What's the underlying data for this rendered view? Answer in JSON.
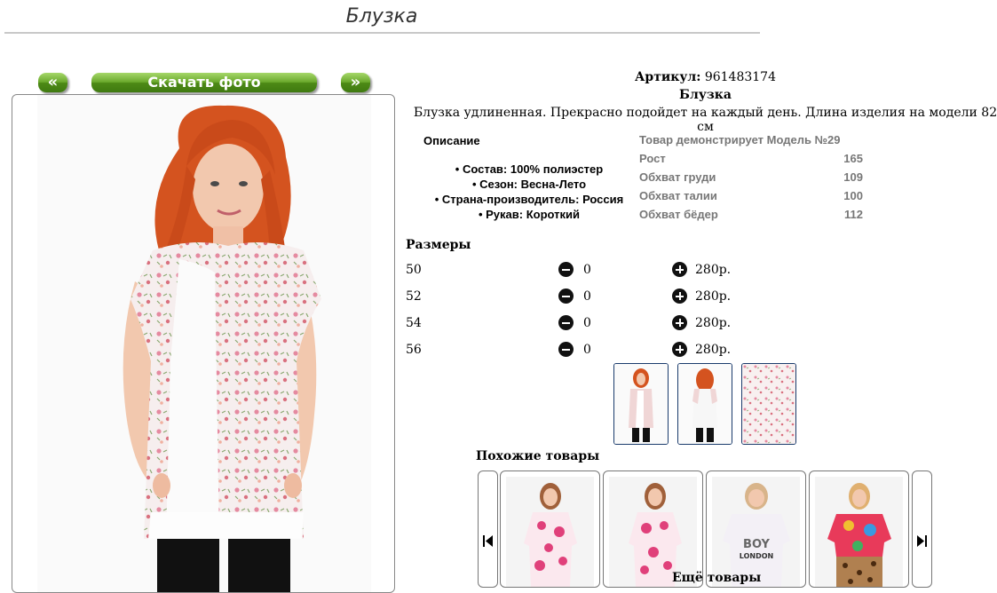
{
  "page": {
    "title": "Блузка"
  },
  "gallery": {
    "prev_label": "«",
    "next_label": "»",
    "download_label": "Скачать фото"
  },
  "product": {
    "sku_label": "Артикул:",
    "sku": "961483174",
    "name": "Блузка",
    "description": "Блузка удлиненная. Прекрасно подойдет на каждый день. Длина изделия на модели 82 см"
  },
  "details": {
    "heading": "Описание",
    "items": [
      "Состав: 100% полиэстер",
      "Сезон: Весна-Лето",
      "Страна-производитель: Россия",
      "Рукав: Короткий"
    ]
  },
  "model": {
    "heading": "Товар демонстрирует Модель №29",
    "rows": [
      {
        "label": "Рост",
        "value": "165"
      },
      {
        "label": "Обхват груди",
        "value": "109"
      },
      {
        "label": "Обхват талии",
        "value": "100"
      },
      {
        "label": "Обхват бёдер",
        "value": "112"
      }
    ]
  },
  "sizes": {
    "heading": "Размеры",
    "rows": [
      {
        "size": "50",
        "qty": "0",
        "price": "280р."
      },
      {
        "size": "52",
        "qty": "0",
        "price": "280р."
      },
      {
        "size": "54",
        "qty": "0",
        "price": "280р."
      },
      {
        "size": "56",
        "qty": "0",
        "price": "280р."
      }
    ]
  },
  "similar": {
    "heading": "Похожие товары",
    "card3_print_line1": "BOY",
    "card3_print_line2": "LONDON",
    "more_label": "Ещё товары"
  },
  "colors": {
    "button_green": "#5a9a1f",
    "thumb_border": "#1a3b6c",
    "hair": "#d4531f",
    "floral_pink": "#e58aa0",
    "floral_green": "#8aa870"
  }
}
